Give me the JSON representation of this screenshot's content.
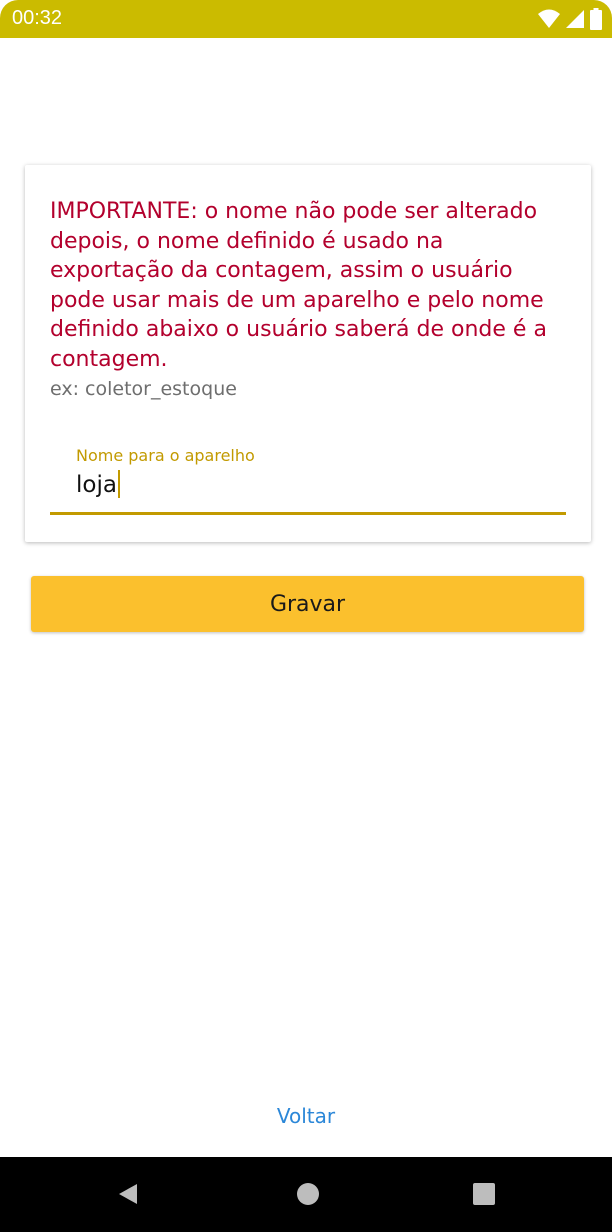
{
  "status_bar": {
    "time": "00:32",
    "icons": [
      "wifi-icon",
      "signal-icon",
      "battery-icon"
    ],
    "background_color": "#cbbb00"
  },
  "card": {
    "warning_text": "IMPORTANTE: o nome não pode ser alterado depois, o nome definido é usado na exportação da contagem, assim o usuário pode usar mais de um aparelho e pelo nome definido abaixo o usuário saberá de onde é a contagem.",
    "example_text": "ex: coletor_estoque",
    "field": {
      "label": "Nome para o aparelho",
      "value": "loja"
    }
  },
  "actions": {
    "save_label": "Gravar",
    "back_label": "Voltar"
  },
  "nav_bar": {
    "icons": [
      "back-icon",
      "home-icon",
      "recents-icon"
    ]
  },
  "colors": {
    "warning": "#b3002d",
    "accent": "#c29a00",
    "button": "#fbc02d",
    "link": "#2b87d8"
  }
}
